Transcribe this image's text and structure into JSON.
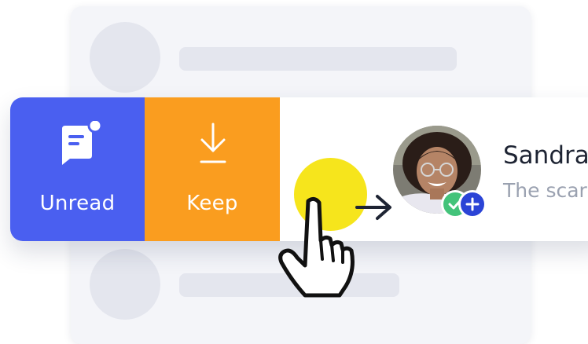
{
  "actions": {
    "unread": {
      "label": "Unread",
      "icon": "chat-bubble-unread-icon",
      "color": "#4a5ff0"
    },
    "keep": {
      "label": "Keep",
      "icon": "download-icon",
      "color": "#fa9d1f"
    }
  },
  "contact": {
    "name": "Sandra",
    "preview": "The scar",
    "avatar": "person-avatar",
    "badges": [
      "check-icon",
      "plus-icon"
    ]
  },
  "gesture": {
    "icon": "hand-pointer-icon",
    "touch_color": "#f6e51c",
    "arrow": "arrow-right-icon"
  }
}
